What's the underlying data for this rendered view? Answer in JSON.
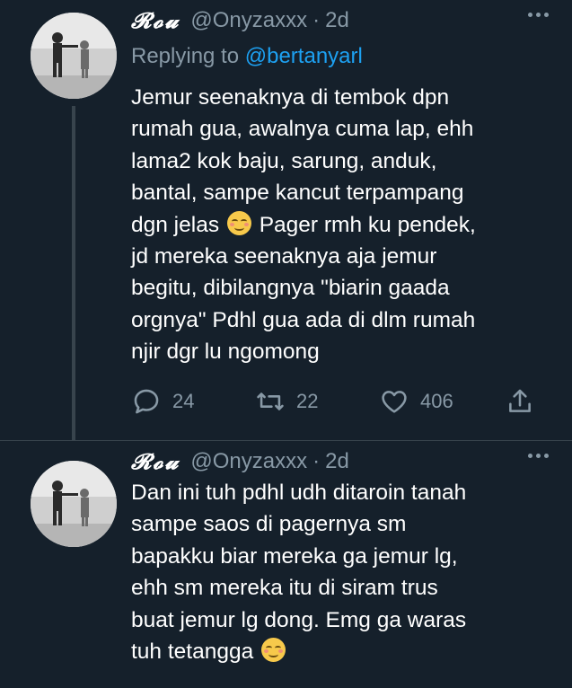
{
  "tweets": [
    {
      "display_name": "𝓡𝓸𝓾",
      "handle": "@Onyzaxxx",
      "separator": "·",
      "time": "2d",
      "replying_prefix": "Replying to",
      "replying_to": "@bertanyarl",
      "text_part1": "Jemur seenaknya di tembok dpn\nrumah gua, awalnya cuma lap, ehh\nlama2 kok baju, sarung, anduk,\nbantal, sampe kancut terpampang\ndgn jelas",
      "text_part2": " Pager rmh ku pendek,\njd mereka seenaknya aja jemur\nbegitu, dibilangnya \"biarin gaada\norgnya\" Pdhl gua ada di dlm rumah\nnjir dgr lu ngomong",
      "emoji": "smiling-face-emoji",
      "replies": "24",
      "retweets": "22",
      "likes": "406"
    },
    {
      "display_name": "𝓡𝓸𝓾",
      "handle": "@Onyzaxxx",
      "separator": "·",
      "time": "2d",
      "text_part1": "Dan ini tuh pdhl udh ditaroin tanah\nsampe saos di pagernya sm\nbapakku biar mereka ga jemur lg,\nehh sm mereka itu di siram trus\nbuat jemur lg dong. Emg ga waras\ntuh tetangga",
      "emoji": "smiling-face-emoji"
    }
  ],
  "colors": {
    "background": "#15202b",
    "muted": "#8899a6",
    "link": "#1da1f2",
    "divider": "#38444d"
  }
}
